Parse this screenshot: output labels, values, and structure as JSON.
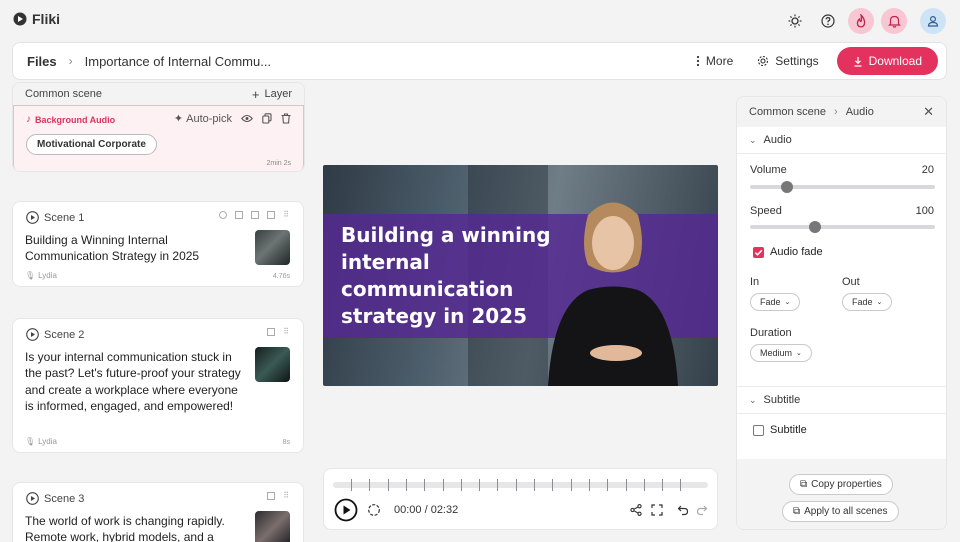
{
  "app": {
    "name": "Fliki"
  },
  "header": {
    "files": "Files",
    "title": "Importance of Internal Commu...",
    "more": "More",
    "settings": "Settings",
    "download": "Download"
  },
  "common_scene": {
    "title": "Common scene",
    "add_layer": "Layer",
    "bg_audio_label": "Background Audio",
    "auto_pick": "Auto-pick",
    "track": "Motivational Corporate",
    "duration": "2min 2s"
  },
  "scenes": [
    {
      "label": "Scene 1",
      "text": "Building a Winning Internal Communication Strategy in 2025",
      "voice": "Lydia",
      "duration": "4.76s"
    },
    {
      "label": "Scene 2",
      "text": "Is your internal communication stuck in the past? Let's future-proof your strategy and create a workplace where everyone is informed, engaged, and empowered!",
      "voice": "Lydia",
      "duration": "8s"
    },
    {
      "label": "Scene 3",
      "text": "The world of work is changing rapidly. Remote work, hybrid models, and a"
    }
  ],
  "preview": {
    "headline": "Building a winning internal communication strategy in 2025"
  },
  "player": {
    "time": "00:00 / 02:32"
  },
  "panel": {
    "crumb_parent": "Common scene",
    "crumb_current": "Audio",
    "audio_section": "Audio",
    "volume_label": "Volume",
    "volume_value": "20",
    "volume_fraction": 0.2,
    "speed_label": "Speed",
    "speed_value": "100",
    "speed_fraction": 0.35,
    "audio_fade_label": "Audio fade",
    "audio_fade_checked": true,
    "in_label": "In",
    "in_value": "Fade",
    "out_label": "Out",
    "out_value": "Fade",
    "duration_label": "Duration",
    "duration_value": "Medium",
    "subtitle_section": "Subtitle",
    "subtitle_check_label": "Subtitle",
    "subtitle_checked": false,
    "copy_properties": "Copy properties",
    "apply_all": "Apply to all scenes"
  },
  "colors": {
    "accent": "#e3325e",
    "overlay": "#562894"
  }
}
